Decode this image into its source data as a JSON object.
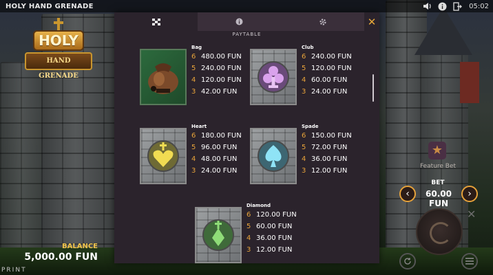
{
  "game": {
    "title": "HOLY HAND GRENADE"
  },
  "topbar": {
    "icons": [
      "speaker-icon",
      "info-icon",
      "exit-icon"
    ],
    "time": "05:02"
  },
  "logo": {
    "line1": "HOLY",
    "line2": "HAND GRENADE"
  },
  "balance": {
    "label": "BALANCE",
    "value": "5,000.00 FUN"
  },
  "print_label": "PRINT",
  "right_panel": {
    "feature_label": "Feature Bet",
    "bet_label": "BET",
    "bet_value": "60.00 FUN"
  },
  "paytable": {
    "tabs": [
      {
        "icon": "paytable-grid-icon",
        "active": true
      },
      {
        "icon": "info-circle-icon",
        "active": false
      },
      {
        "icon": "gear-icon",
        "active": false
      }
    ],
    "close": "✕",
    "section_title": "PAYTABLE",
    "symbols": [
      {
        "name": "Bag",
        "pays": [
          {
            "count": "6",
            "amount": "480.00 FUN"
          },
          {
            "count": "5",
            "amount": "240.00 FUN"
          },
          {
            "count": "4",
            "amount": "120.00 FUN"
          },
          {
            "count": "3",
            "amount": "42.00 FUN"
          }
        ]
      },
      {
        "name": "Club",
        "pays": [
          {
            "count": "6",
            "amount": "240.00 FUN"
          },
          {
            "count": "5",
            "amount": "120.00 FUN"
          },
          {
            "count": "4",
            "amount": "60.00 FUN"
          },
          {
            "count": "3",
            "amount": "24.00 FUN"
          }
        ]
      },
      {
        "name": "Heart",
        "pays": [
          {
            "count": "6",
            "amount": "180.00 FUN"
          },
          {
            "count": "5",
            "amount": "96.00 FUN"
          },
          {
            "count": "4",
            "amount": "48.00 FUN"
          },
          {
            "count": "3",
            "amount": "24.00 FUN"
          }
        ]
      },
      {
        "name": "Spade",
        "pays": [
          {
            "count": "6",
            "amount": "150.00 FUN"
          },
          {
            "count": "5",
            "amount": "72.00 FUN"
          },
          {
            "count": "4",
            "amount": "36.00 FUN"
          },
          {
            "count": "3",
            "amount": "12.00 FUN"
          }
        ]
      },
      {
        "name": "Diamond",
        "pays": [
          {
            "count": "6",
            "amount": "120.00 FUN"
          },
          {
            "count": "5",
            "amount": "60.00 FUN"
          },
          {
            "count": "4",
            "amount": "36.00 FUN"
          },
          {
            "count": "3",
            "amount": "12.00 FUN"
          }
        ]
      }
    ]
  },
  "colors": {
    "accent": "#e9a43a",
    "panel": "#2b232c",
    "club": "#b56ad0",
    "heart": "#e7d046",
    "spade": "#55c7e6",
    "diamond": "#67b35a"
  }
}
